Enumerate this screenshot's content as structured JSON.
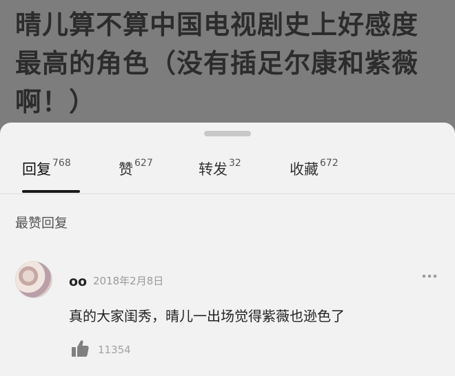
{
  "post": {
    "title": "晴儿算不算中国电视剧史上好感度最高的角色（没有插足尔康和紫薇啊！）"
  },
  "tabs": [
    {
      "label": "回复",
      "count": "768"
    },
    {
      "label": "赞",
      "count": "627"
    },
    {
      "label": "转发",
      "count": "32"
    },
    {
      "label": "收藏",
      "count": "672"
    }
  ],
  "section": {
    "title": "最赞回复"
  },
  "comment": {
    "author": "oo",
    "date": "2018年2月8日",
    "text": "真的大家闺秀，晴儿一出场觉得紫薇也逊色了",
    "likes": "11354"
  },
  "icons": {
    "more": "more-dots-icon",
    "like": "thumbs-up-icon"
  },
  "colors": {
    "header_bg": "#7d7d7d",
    "sheet_bg": "#f2f2f2",
    "active_tab_underline": "#1a1a1a"
  }
}
